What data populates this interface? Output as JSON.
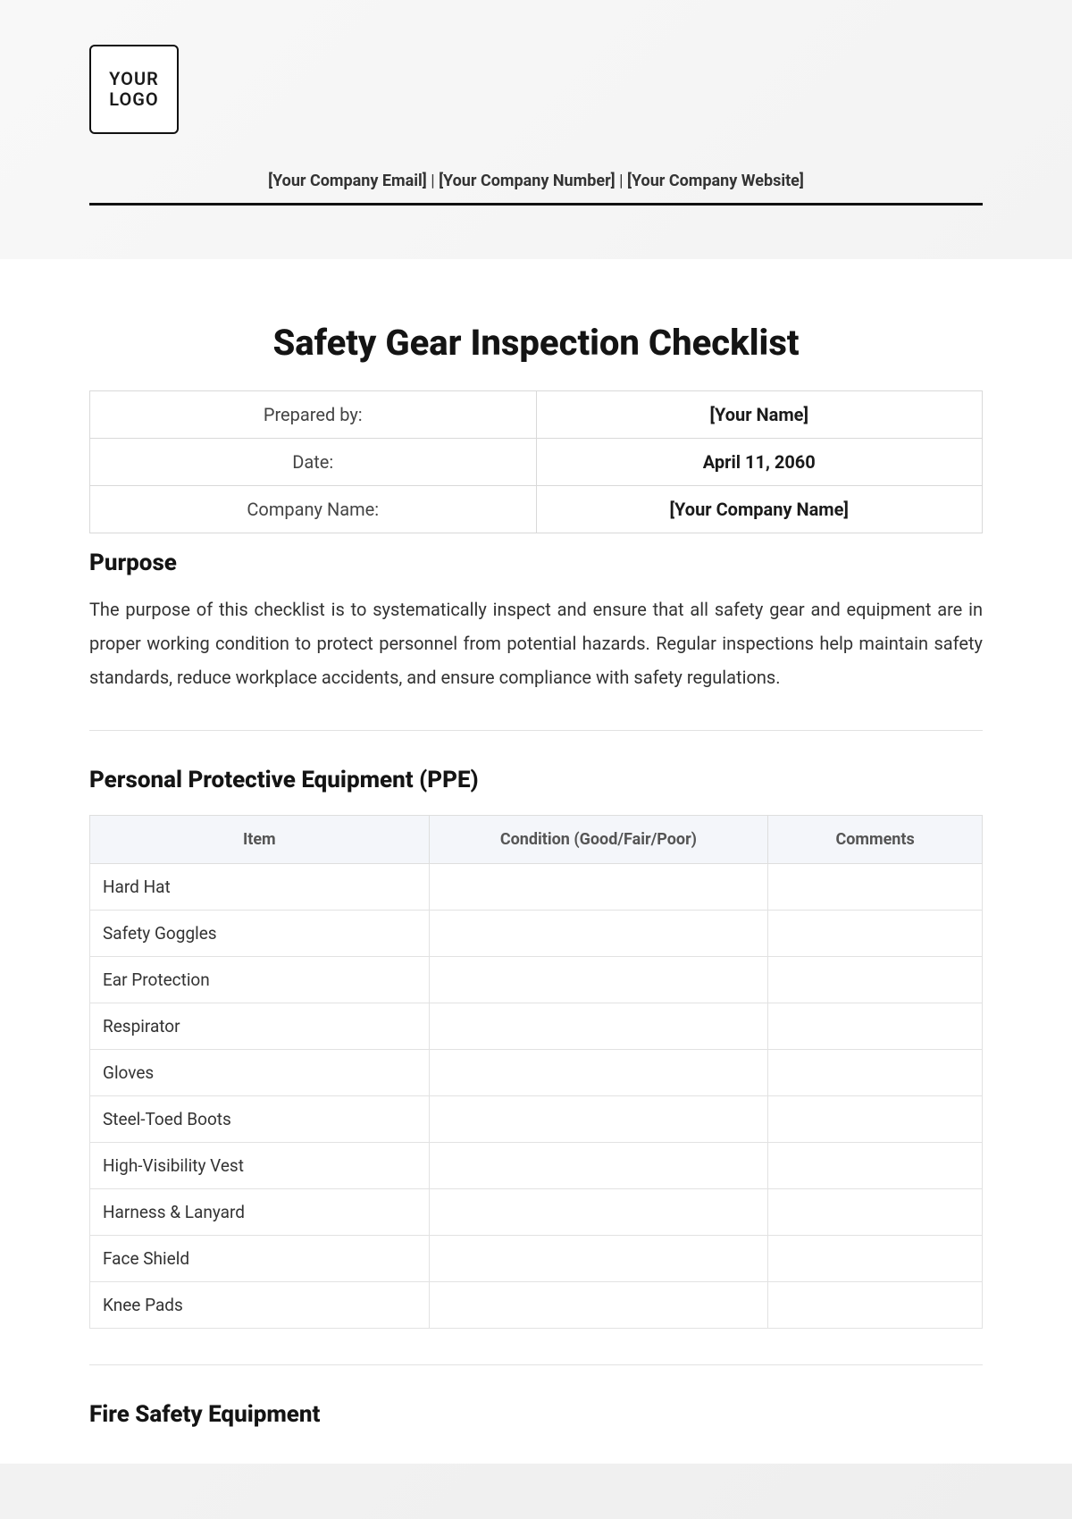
{
  "header": {
    "logo_line1": "YOUR",
    "logo_line2": "LOGO",
    "email": "[Your Company Email]",
    "phone": "[Your Company Number]",
    "website": "[Your Company Website]",
    "sep": " | "
  },
  "title": "Safety Gear Inspection Checklist",
  "info": {
    "prepared_by_label": "Prepared by:",
    "prepared_by_value": "[Your Name]",
    "date_label": "Date:",
    "date_value": "April 11, 2060",
    "company_label": "Company Name:",
    "company_value": "[Your Company Name]"
  },
  "purpose": {
    "heading": "Purpose",
    "text": "The purpose of this checklist is to systematically inspect and ensure that all safety gear and equipment are in proper working condition to protect personnel from potential hazards. Regular inspections help maintain safety standards, reduce workplace accidents, and ensure compliance with safety regulations."
  },
  "ppe": {
    "heading": "Personal Protective Equipment (PPE)",
    "columns": {
      "item": "Item",
      "condition": "Condition (Good/Fair/Poor)",
      "comments": "Comments"
    },
    "rows": [
      {
        "item": "Hard Hat",
        "condition": "",
        "comments": ""
      },
      {
        "item": "Safety Goggles",
        "condition": "",
        "comments": ""
      },
      {
        "item": "Ear Protection",
        "condition": "",
        "comments": ""
      },
      {
        "item": "Respirator",
        "condition": "",
        "comments": ""
      },
      {
        "item": "Gloves",
        "condition": "",
        "comments": ""
      },
      {
        "item": "Steel-Toed Boots",
        "condition": "",
        "comments": ""
      },
      {
        "item": "High-Visibility Vest",
        "condition": "",
        "comments": ""
      },
      {
        "item": "Harness & Lanyard",
        "condition": "",
        "comments": ""
      },
      {
        "item": "Face Shield",
        "condition": "",
        "comments": ""
      },
      {
        "item": "Knee Pads",
        "condition": "",
        "comments": ""
      }
    ]
  },
  "fire": {
    "heading": "Fire Safety Equipment"
  }
}
